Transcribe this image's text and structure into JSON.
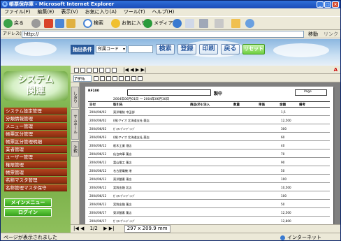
{
  "window": {
    "title": "帳票保存庫 - Microsoft Internet Explorer"
  },
  "menu": [
    "ファイル(F)",
    "編集(E)",
    "表示(V)",
    "お気に入り(A)",
    "ツール(T)",
    "ヘルプ(H)"
  ],
  "toolbar": {
    "back": "戻る",
    "search": "検索",
    "favorites": "お気に入り",
    "media": "メディア"
  },
  "address": {
    "label": "アドレス(D)",
    "value": "http://",
    "go": "移動",
    "links": "リンク"
  },
  "search": {
    "label": "抽出条件",
    "select_value": "所属コード",
    "buttons": [
      "検索",
      "登録",
      "印刷",
      "戻る",
      "リセット"
    ]
  },
  "sidebar": {
    "logo_line1": "システム",
    "logo_line2": "関連",
    "items": [
      "システム設定管理",
      "分類情報管理",
      "メニュー管理",
      "帳票区分管理",
      "帳票区分管理明細",
      "業者管理",
      "ユーザー管理",
      "権限管理",
      "帳票管理",
      "名称マスタ管理",
      "名称管理マスタ保守"
    ],
    "menu_button": "メインメニュー",
    "login_button": "ログイン"
  },
  "viewer": {
    "zoom": "79%",
    "tabs": [
      "しおり",
      "サムネール",
      "注釈"
    ],
    "page": "1/2",
    "size": "297 x 209.9 mm"
  },
  "report": {
    "code": "RF100",
    "stamp": "製中",
    "period": "2004年06月01日 ～ 2004年06月30日",
    "page_label": "Page",
    "col_headers": [
      "日付",
      "取引先",
      "商品(外)/注入",
      "数量",
      "単価",
      "金額",
      "備考"
    ],
    "rows": [
      {
        "date": "2004/06/02",
        "name": "東洋電装 中田部"
      },
      {
        "date": "2004/06/02",
        "name": "(株)アイオ 北海道支社 薬店"
      },
      {
        "date": "2004/06/02",
        "name": "ｶﾞｽﾃﾝﾌﾟﾙｰﾃﾞｨﾝｸﾞ"
      },
      {
        "date": "2004/06/03",
        "name": "(株)アイオ 北海道支社 薬店"
      },
      {
        "date": "2004/06/12",
        "name": "栃木工業 港店"
      },
      {
        "date": "2004/06/12",
        "name": "仙台商事 薬店"
      },
      {
        "date": "2004/06/12",
        "name": "富山電工 薬店"
      },
      {
        "date": "2004/06/12",
        "name": "名古屋電機 港"
      },
      {
        "date": "2004/06/12",
        "name": "東洋酸素 東店"
      },
      {
        "date": "2004/06/12",
        "name": "実践金融 北店"
      },
      {
        "date": "2004/06/12",
        "name": "ｶﾞｽﾃﾝﾌﾟﾙｰﾃﾞｨﾝｸﾞ"
      },
      {
        "date": "2004/06/12",
        "name": "実践金融 薬店"
      },
      {
        "date": "2004/06/17",
        "name": "東洋酸素 薬店"
      },
      {
        "date": "2004/06/17",
        "name": "ｶﾞｽﾃﾝﾌﾟﾙｰﾃﾞｨﾝｸﾞ"
      }
    ],
    "amounts": [
      "1,5",
      "12,500",
      "300",
      "60",
      "40",
      "70",
      "90",
      "50",
      "100",
      "10,500",
      "100",
      "50",
      "12,500",
      "12,800",
      "50"
    ]
  },
  "status": {
    "left": "ページが表示されました",
    "right": "インターネット"
  }
}
